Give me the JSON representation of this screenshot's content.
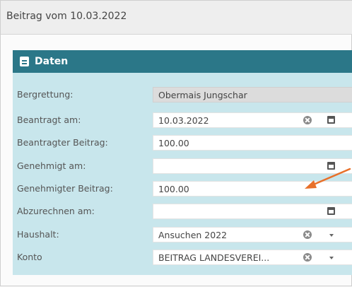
{
  "window": {
    "title": "Beitrag vom 10.03.2022"
  },
  "panel": {
    "title": "Daten",
    "icon": "list-icon"
  },
  "fields": {
    "bergrettung": {
      "label": "Bergrettung:",
      "value": "Obermais Jungschar"
    },
    "beantragt_am": {
      "label": "Beantragt am:",
      "value": "10.03.2022"
    },
    "beantragter_beitrag": {
      "label": "Beantragter Beitrag:",
      "value": "100.00"
    },
    "genehmigt_am": {
      "label": "Genehmigt am:",
      "value": ""
    },
    "genehmigter_beitrag": {
      "label": "Genehmigter Beitrag:",
      "value": "100.00"
    },
    "abzurechnen_am": {
      "label": "Abzurechnen am:",
      "value": ""
    },
    "haushalt": {
      "label": "Haushalt:",
      "value": "Ansuchen 2022"
    },
    "konto": {
      "label": "Konto",
      "value": "BEITRAG LANDESVEREI..."
    }
  },
  "annotation": {
    "color": "#e8702a"
  }
}
